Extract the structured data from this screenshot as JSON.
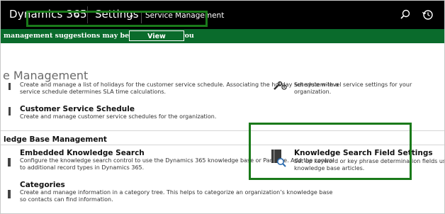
{
  "header": {
    "app_title": "Dynamics 365",
    "area_label": "Settings",
    "breadcrumb": "Service Management",
    "search_icon": "search-icon",
    "history_icon": "history-icon"
  },
  "notice": {
    "text": "management suggestions may be available for you",
    "button_label": "View Suggestions",
    "color": "#0a6b2c"
  },
  "main": {
    "page_heading": "e Management",
    "holiday": {
      "desc_line1": "Create and manage a list of holidays for the customer service schedule. Associating the holiday schedule with a",
      "desc_line2": "service schedule determines SLA time calculations."
    },
    "service_config": {
      "desc": "Set system-level service settings for your organization."
    },
    "customer_service_schedule": {
      "title": "Customer Service Schedule",
      "desc": "Create and manage customer service schedules for the organization."
    },
    "kb_section_heading": "ledge Base Management",
    "embedded_knowledge_search": {
      "title": "Embedded Knowledge Search",
      "desc_line1": "Configure the knowledge search control to use the Dynamics 365 knowledge base or Parature. Add the control",
      "desc_line2": "to additional record types in Dynamics 365."
    },
    "knowledge_search_field_settings": {
      "title": "Knowledge Search Field Settings",
      "desc_line1": "Set up keyword or key phrase determination fields using Azure Ma",
      "desc_line2": "knowledge base articles."
    },
    "categories": {
      "title": "Categories",
      "desc_line1": "Create and manage information in a category tree. This helps to categorize an organization’s knowledge base",
      "desc_line2": "so contacts can find information."
    }
  },
  "colors": {
    "topbar": "#000000",
    "highlight": "#1a7a1a"
  }
}
